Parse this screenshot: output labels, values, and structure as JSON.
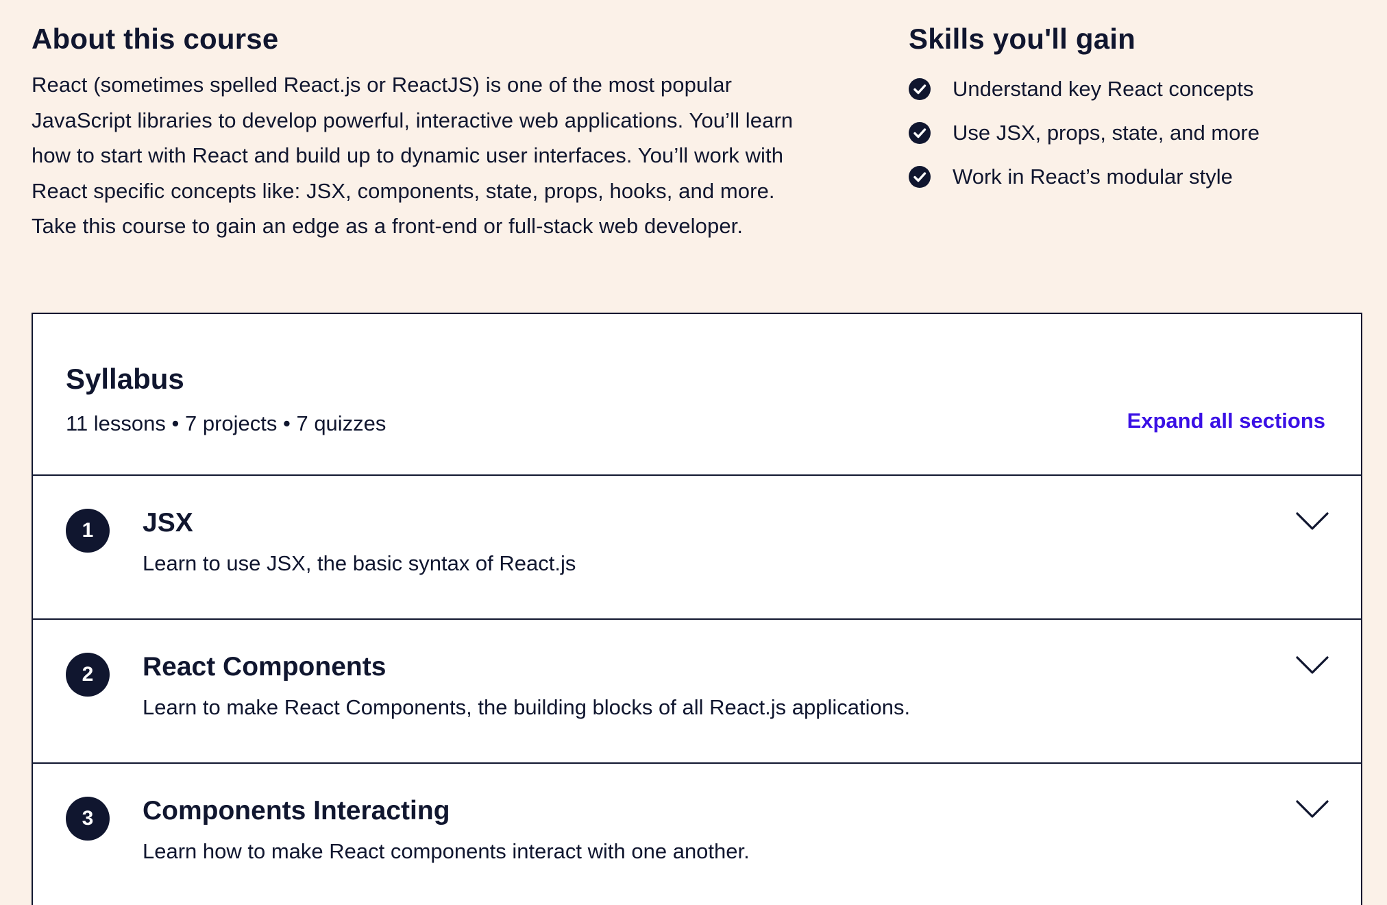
{
  "about": {
    "title": "About this course",
    "lines": [
      "React (sometimes spelled React.js or ReactJS) is one of the most popular",
      "JavaScript libraries to develop powerful, interactive web applications. You’ll learn",
      "how to start with React and build up to dynamic user interfaces. You’ll work with",
      "React specific concepts like: JSX, components, state, props, hooks, and more.",
      "Take this course to gain an edge as a front-end or full-stack web developer."
    ]
  },
  "skills": {
    "title": "Skills you'll gain",
    "items": [
      {
        "label": "Understand key React concepts",
        "icon": "check-circle-icon"
      },
      {
        "label": "Use JSX, props, state, and more",
        "icon": "check-circle-icon"
      },
      {
        "label": "Work in React’s modular style",
        "icon": "check-circle-icon"
      }
    ]
  },
  "syllabus": {
    "title": "Syllabus",
    "meta": "11 lessons • 7 projects • 7 quizzes",
    "expand_label": "Expand all sections",
    "modules": [
      {
        "number": "1",
        "title": "JSX",
        "description": "Learn to use JSX, the basic syntax of React.js"
      },
      {
        "number": "2",
        "title": "React Components",
        "description": "Learn to make React Components, the building blocks of all React.js applications."
      },
      {
        "number": "3",
        "title": "Components Interacting",
        "description": "Learn how to make React components interact with one another."
      }
    ]
  },
  "colors": {
    "page_background": "#fbf1e8",
    "text": "#10162f",
    "link": "#3a10e5",
    "card_background": "#ffffff"
  }
}
